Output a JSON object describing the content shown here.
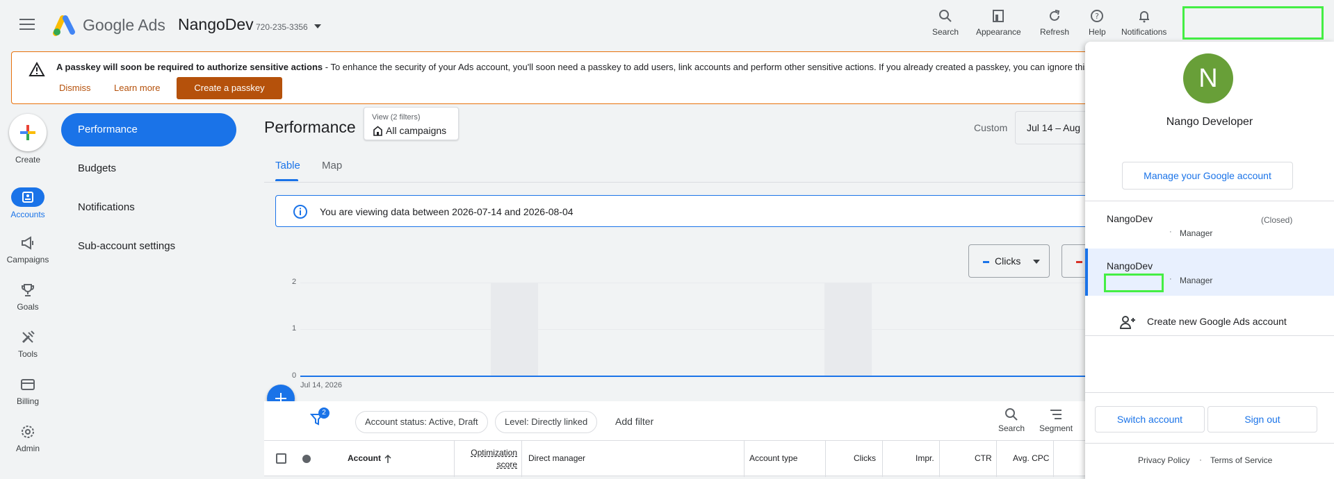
{
  "header": {
    "brand": "Google Ads",
    "account_name": "NangoDev",
    "account_id": "720-235-3356",
    "tools": [
      {
        "label": "Search",
        "icon": "search-icon"
      },
      {
        "label": "Appearance",
        "icon": "appearance-icon"
      },
      {
        "label": "Refresh",
        "icon": "refresh-icon"
      },
      {
        "label": "Help",
        "icon": "help-icon"
      },
      {
        "label": "Notifications",
        "icon": "bell-icon"
      }
    ]
  },
  "banner": {
    "title": "A passkey will soon be required to authorize sensitive actions",
    "body": " - To enhance the security of your Ads account, you'll soon need a passkey to add users, link accounts and perform other sensitive actions. If you already created a passkey, you can ignore this mes",
    "dismiss": "Dismiss",
    "learn_more": "Learn more",
    "create_passkey": "Create a passkey"
  },
  "rail": {
    "create": "Create",
    "items": [
      {
        "label": "Accounts",
        "icon": "accounts-icon",
        "active": true
      },
      {
        "label": "Campaigns",
        "icon": "megaphone-icon"
      },
      {
        "label": "Goals",
        "icon": "trophy-icon"
      },
      {
        "label": "Tools",
        "icon": "tools-icon"
      },
      {
        "label": "Billing",
        "icon": "card-icon"
      },
      {
        "label": "Admin",
        "icon": "gear-icon"
      }
    ]
  },
  "subnav": {
    "items": [
      {
        "label": "Performance",
        "active": true
      },
      {
        "label": "Budgets"
      },
      {
        "label": "Notifications"
      },
      {
        "label": "Sub-account settings"
      }
    ]
  },
  "main": {
    "title": "Performance",
    "view_small": "View (2 filters)",
    "view_big": "All campaigns",
    "custom_label": "Custom",
    "date_range": "Jul 14 – Aug",
    "tabs": [
      {
        "label": "Table"
      },
      {
        "label": "Map"
      }
    ],
    "info": "You are viewing data between 2026-07-14 and 2026-08-04",
    "metric1": "Clicks"
  },
  "chart_data": {
    "type": "line",
    "series": [
      {
        "name": "Clicks",
        "values": [
          0,
          0
        ]
      }
    ],
    "x": [
      "Jul 14, 2026"
    ],
    "yticks": [
      "2",
      "1",
      "0"
    ],
    "ylim": [
      0,
      2
    ],
    "grid": true,
    "colors": {
      "clicks": "#1a73e8"
    }
  },
  "filters": {
    "badge": "2",
    "chips": [
      "Account status: Active, Draft",
      "Level: Directly linked"
    ],
    "add_filter": "Add filter",
    "search": "Search",
    "segment": "Segment"
  },
  "table": {
    "columns": [
      "Account",
      "Optimization",
      "score",
      "Direct manager",
      "Account type",
      "Clicks",
      "Impr.",
      "CTR",
      "Avg. CPC"
    ]
  },
  "panel": {
    "initial": "N",
    "name": "Nango Developer",
    "manage": "Manage your Google account",
    "accounts": [
      {
        "name": "NangoDev",
        "role": "Manager",
        "status": "(Closed)"
      },
      {
        "name": "NangoDev",
        "role": "Manager"
      }
    ],
    "dot": "·",
    "create_new": "Create new Google Ads account",
    "switch": "Switch account",
    "sign_out": "Sign out",
    "privacy": "Privacy Policy",
    "terms": "Terms of Service"
  },
  "colors": {
    "accent": "#1a73e8",
    "warning": "#b5510b",
    "avatar": "#689f38"
  }
}
